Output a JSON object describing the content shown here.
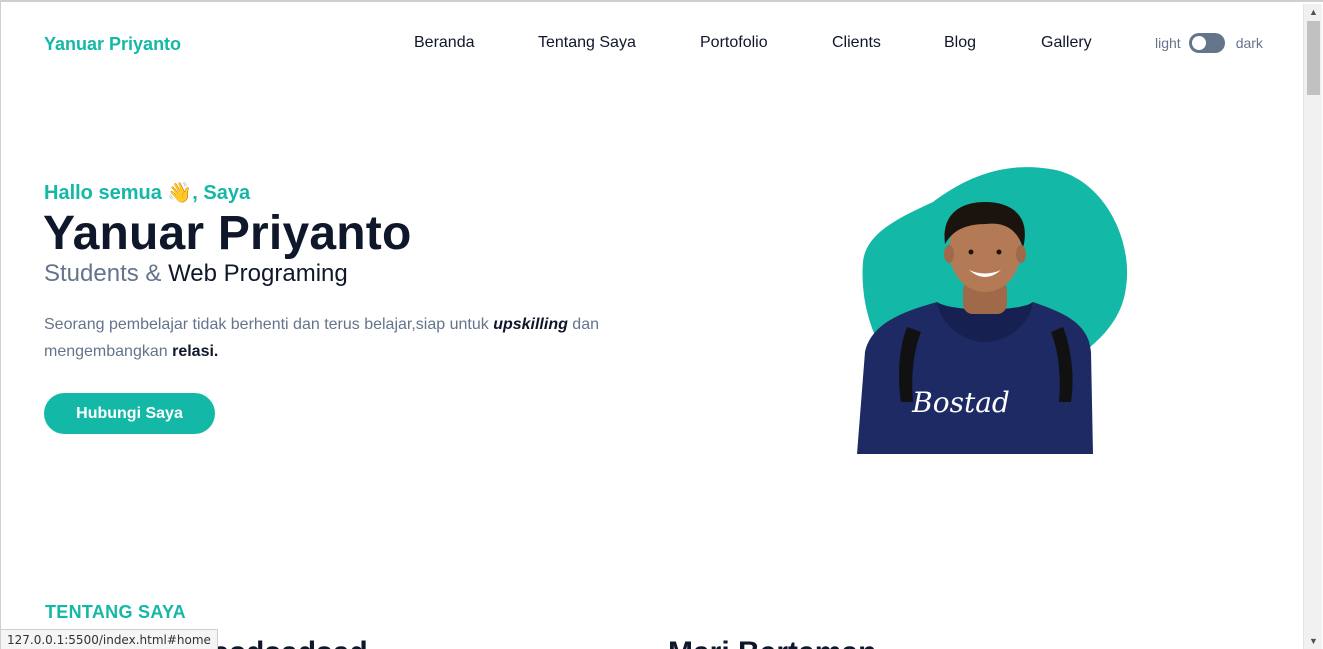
{
  "brand": "Yanuar Priyanto",
  "nav": {
    "items": [
      "Beranda",
      "Tentang Saya",
      "Portofolio",
      "Clients",
      "Blog",
      "Gallery"
    ]
  },
  "theme_toggle": {
    "light_label": "light",
    "dark_label": "dark",
    "mode": "light"
  },
  "hero": {
    "greeting_prefix": "Hallo semua ",
    "greeting_emoji": "👋",
    "greeting_suffix": ", Saya",
    "name": "Yanuar Priyanto",
    "role_primary": "Students",
    "role_amp": " & ",
    "role_secondary": "Web Programing",
    "desc_part1": "Seorang pembelajar tidak berhenti dan terus belajar,siap untuk ",
    "desc_em": "upskilling",
    "desc_part2": " dan mengembangkan ",
    "desc_strong": "relasi.",
    "cta_label": "Hubungi Saya",
    "photo_shirt_text": "Bostad"
  },
  "about": {
    "section_title": "TENTANG SAYA",
    "peek_left": "Hasdsadsad",
    "peek_right": "Mari Berteman"
  },
  "browser": {
    "status_url": "127.0.0.1:5500/index.html#home"
  },
  "colors": {
    "accent": "#14b8a6",
    "heading": "#0f172a",
    "muted": "#64748b"
  }
}
